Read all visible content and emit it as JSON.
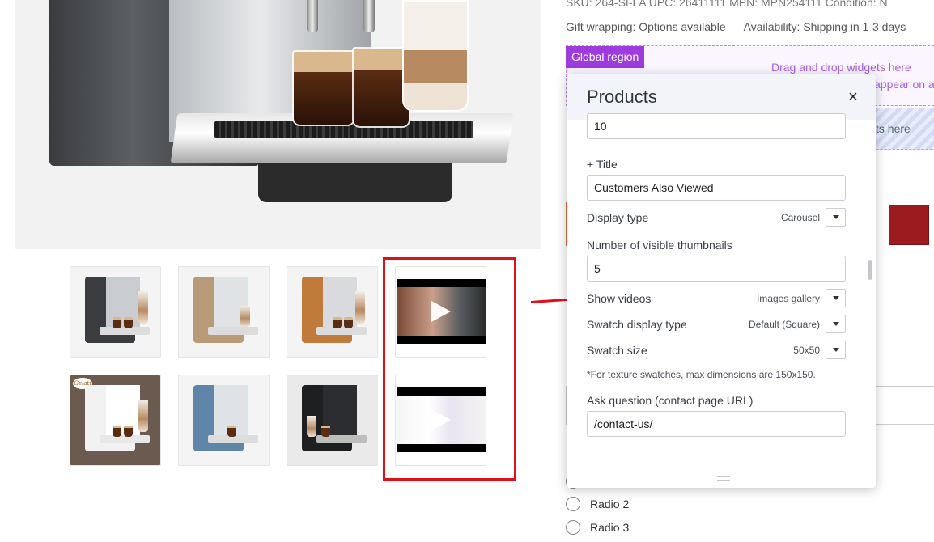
{
  "product_info": {
    "top_line": "SKU: 264-SI-LA    UPC: 26411111    MPN: MPN254111    Condition: N",
    "gift_wrapping": "Gift wrapping: Options available",
    "availability": "Availability: Shipping in 1-3 days"
  },
  "global_region": {
    "tag": "Global region",
    "drop_hint_line1": "Drag and drop widgets here",
    "drop_hint_line2": "appear on a",
    "region2_hint": "ts here"
  },
  "options": {
    "radios": [
      "Radio 2",
      "Radio 3"
    ],
    "swatch_color": "#9b1b1f"
  },
  "gallery": {
    "thumbnails": [
      {
        "type": "image",
        "name": "thumb-silver-machine"
      },
      {
        "type": "image",
        "name": "thumb-beige-machine"
      },
      {
        "type": "image",
        "name": "thumb-copper-machine"
      },
      {
        "type": "video",
        "name": "thumb-video-1"
      },
      {
        "type": "image",
        "name": "thumb-white-machine",
        "badge": "Gelati"
      },
      {
        "type": "image",
        "name": "thumb-blue-machine"
      },
      {
        "type": "image",
        "name": "thumb-black-machine"
      },
      {
        "type": "video",
        "name": "thumb-video-2"
      }
    ],
    "highlight_color": "#e0101a"
  },
  "panel": {
    "title": "Products",
    "close_icon": "×",
    "fields": {
      "limit_value": "10",
      "title_label": "+ Title",
      "title_value": "Customers Also Viewed",
      "display_type_label": "Display type",
      "display_type_value": "Carousel",
      "visible_thumbs_label": "Number of visible thumbnails",
      "visible_thumbs_value": "5",
      "show_videos_label": "Show videos",
      "show_videos_value": "Images gallery",
      "swatch_display_label": "Swatch display type",
      "swatch_display_value": "Default (Square)",
      "swatch_size_label": "Swatch size",
      "swatch_size_value": "50x50",
      "swatch_note": "*For texture swatches, max dimensions are 150x150.",
      "ask_question_label": "Ask question (contact page URL)",
      "ask_question_value": "/contact-us/"
    }
  }
}
